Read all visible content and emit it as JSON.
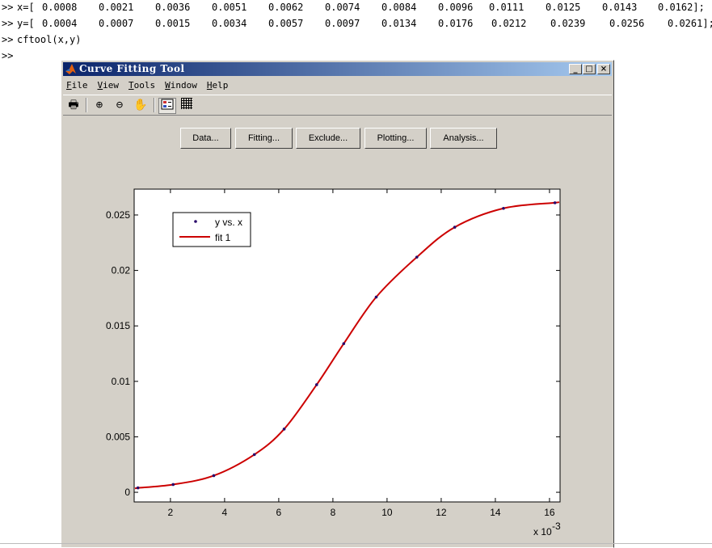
{
  "console": {
    "lines": [
      {
        "prompt": ">>",
        "code": "x=[",
        "values": [
          "0.0008",
          "0.0021",
          "0.0036",
          "0.0051",
          "0.0062",
          "0.0074",
          "0.0084",
          "0.0096",
          "0.0111",
          "0.0125",
          "0.0143",
          "0.0162];"
        ]
      },
      {
        "prompt": ">>",
        "code": "y=[",
        "values": [
          "0.0004",
          "0.0007",
          "0.0015",
          "0.0034",
          "0.0057",
          "0.0097",
          "0.0134",
          "0.0176",
          "0.0212",
          "0.0239",
          "0.0256",
          "0.0261];"
        ]
      },
      {
        "prompt": ">>",
        "code": "cftool(x,y)",
        "values": []
      },
      {
        "prompt": ">>",
        "code": "",
        "values": []
      }
    ]
  },
  "window": {
    "title": "Curve Fitting Tool",
    "menu": [
      "File",
      "View",
      "Tools",
      "Window",
      "Help"
    ],
    "toolbar": [
      "print-icon",
      "zoom-in-icon",
      "zoom-out-icon",
      "pan-hand-icon",
      "legend-icon",
      "grid-icon"
    ],
    "buttons": [
      "Data...",
      "Fitting...",
      "Exclude...",
      "Plotting...",
      "Analysis..."
    ],
    "win_buttons": [
      "_",
      "□",
      "×"
    ]
  },
  "colors": {
    "fit": "#cc0000",
    "points": "#2a0a6a",
    "titlebar": "#0a246a"
  },
  "chart_data": {
    "type": "line",
    "x": [
      0.0008,
      0.0021,
      0.0036,
      0.0051,
      0.0062,
      0.0074,
      0.0084,
      0.0096,
      0.0111,
      0.0125,
      0.0143,
      0.0162
    ],
    "y": [
      0.0004,
      0.0007,
      0.0015,
      0.0034,
      0.0057,
      0.0097,
      0.0134,
      0.0176,
      0.0212,
      0.0239,
      0.0256,
      0.0261
    ],
    "series": [
      {
        "name": "y vs. x",
        "style": "points"
      },
      {
        "name": "fit 1",
        "style": "line"
      }
    ],
    "xlim": [
      0.00066,
      0.01639
    ],
    "ylim": [
      -0.00087,
      0.02733
    ],
    "xticks": [
      2,
      4,
      6,
      8,
      10,
      12,
      14,
      16
    ],
    "xtick_scale": 0.001,
    "xscale_label": "x 10",
    "xscale_exp": "-3",
    "yticks": [
      0,
      0.005,
      0.01,
      0.015,
      0.02,
      0.025
    ],
    "ytick_labels": [
      "0",
      "0.005",
      "0.01",
      "0.015",
      "0.02",
      "0.025"
    ],
    "legend_position": "top-left"
  }
}
